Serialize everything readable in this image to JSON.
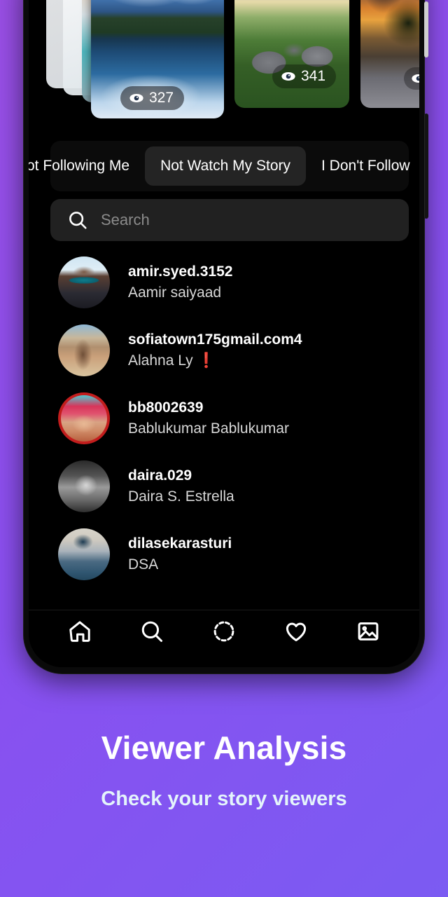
{
  "promo": {
    "title": "Viewer Analysis",
    "subtitle": "Check your story viewers"
  },
  "colors": {
    "background_start": "#9a4fe6",
    "background_end": "#7b5bf2",
    "screen_bg": "#000000",
    "tab_active_bg": "#242424",
    "search_bg": "#212121",
    "text_primary": "#ffffff",
    "text_secondary": "#d8d8d8",
    "placeholder": "#8b8b8b"
  },
  "stories": [
    {
      "id": "story-card-1",
      "views": "327",
      "scene": "mountain-lake-reflection",
      "icon": "eye-icon"
    },
    {
      "id": "story-card-2",
      "views": "341",
      "scene": "green-hills-huts",
      "icon": "eye-icon"
    },
    {
      "id": "story-card-3",
      "views": "",
      "scene": "sunset-cliff-tree",
      "icon": "eye-icon"
    }
  ],
  "tabs": [
    {
      "label": "ot Following Me",
      "active": false,
      "name": "tab-not-following-me"
    },
    {
      "label": "Not Watch My Story",
      "active": true,
      "name": "tab-not-watch-my-story"
    },
    {
      "label": "I Don't Follow",
      "active": false,
      "name": "tab-i-dont-follow"
    }
  ],
  "search": {
    "placeholder": "Search",
    "value": "",
    "icon": "search-icon"
  },
  "users": [
    {
      "username": "amir.syed.3152",
      "fullname": "Aamir saiyaad",
      "avatar": "man-sunglasses"
    },
    {
      "username": "sofiatown175gmail.com4",
      "fullname": "Alahna Ly ❗",
      "avatar": "woman-beach"
    },
    {
      "username": "bb8002639",
      "fullname": "Bablukumar Bablukumar",
      "avatar": "baby-red-frame"
    },
    {
      "username": "daira.029",
      "fullname": "Daira S. Estrella",
      "avatar": "girl-bw"
    },
    {
      "username": "dilasekarasturi",
      "fullname": "DSA",
      "avatar": "woman-hijab"
    }
  ],
  "bottom_nav": [
    {
      "name": "nav-home",
      "icon": "home-icon"
    },
    {
      "name": "nav-search",
      "icon": "search-icon"
    },
    {
      "name": "nav-story",
      "icon": "dashed-circle-icon"
    },
    {
      "name": "nav-likes",
      "icon": "heart-icon"
    },
    {
      "name": "nav-gallery",
      "icon": "image-icon"
    }
  ]
}
